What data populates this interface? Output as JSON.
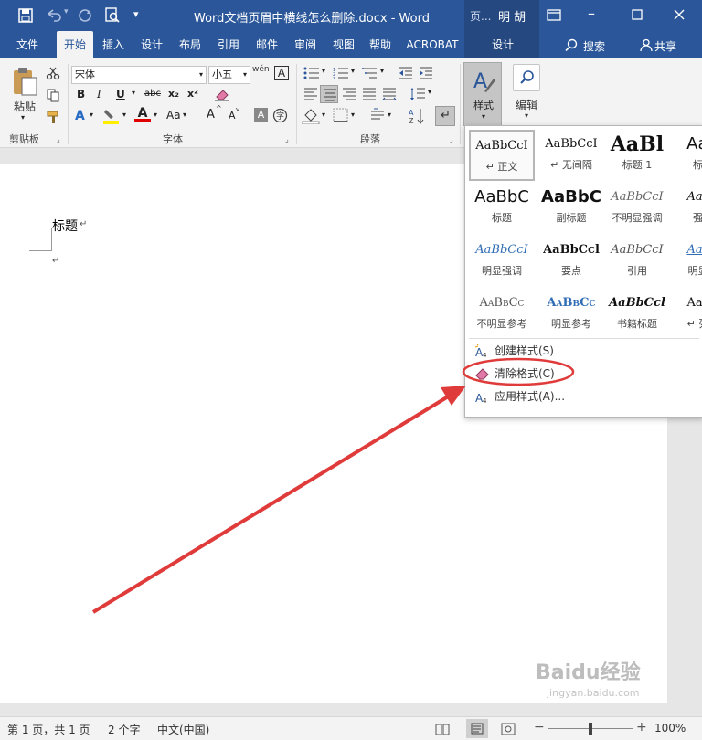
{
  "titlebar": {
    "title": "Word文档页眉中横线怎么删除.docx - Word",
    "context_tab": "页...",
    "user": "明 胡"
  },
  "tabs": [
    "文件",
    "开始",
    "插入",
    "设计",
    "布局",
    "引用",
    "邮件",
    "审阅",
    "视图",
    "帮助",
    "ACROBAT",
    "设计"
  ],
  "search_label": "搜索",
  "share_label": "共享",
  "ribbon": {
    "paste": "粘贴",
    "clipboard_group": "剪贴板",
    "font_name": "宋体",
    "font_size": "小五",
    "font_group": "字体",
    "paragraph_group": "段落",
    "styles_button": "样式",
    "edit_button": "编辑",
    "fmt_bold": "B",
    "fmt_italic": "I",
    "fmt_underline": "U",
    "fmt_strike": "abc",
    "fmt_sub": "x₂",
    "fmt_sup": "x²",
    "fmt_case": "Aa",
    "fmt_grow": "A",
    "fmt_shrink": "A",
    "fmt_clear": "A",
    "wen": "wén",
    "char_border": "A"
  },
  "document": {
    "heading_text": "标题",
    "mark1": "↵",
    "mark2": "↵"
  },
  "styles_gallery": [
    {
      "preview": "AaBbCcI",
      "name": "↵ 正文"
    },
    {
      "preview": "AaBbCcI",
      "name": "↵ 无间隔"
    },
    {
      "preview": "AaBl",
      "name": "标题 1"
    },
    {
      "preview": "AaB",
      "name": "标题"
    },
    {
      "preview": "AaBbC",
      "name": "标题"
    },
    {
      "preview": "AaBbC",
      "name": "副标题"
    },
    {
      "preview": "AaBbCcI",
      "name": "不明显强调"
    },
    {
      "preview": "AaBb",
      "name": "强调"
    },
    {
      "preview": "AaBbCcI",
      "name": "明显强调"
    },
    {
      "preview": "AaBbCcl",
      "name": "要点"
    },
    {
      "preview": "AaBbCcI",
      "name": "引用"
    },
    {
      "preview": "AaBb",
      "name": "明显引"
    },
    {
      "preview": "AaBbCc",
      "name": "不明显参考"
    },
    {
      "preview": "AaBbCc",
      "name": "明显参考"
    },
    {
      "preview": "AaBbCcl",
      "name": "书籍标题"
    },
    {
      "preview": "AaBb",
      "name": "↵ 列表"
    }
  ],
  "styles_menu": [
    {
      "label": "创建样式(S)",
      "icon": "create-style-icon"
    },
    {
      "label": "清除格式(C)",
      "icon": "eraser-icon"
    },
    {
      "label": "应用样式(A)...",
      "icon": "apply-style-icon"
    }
  ],
  "status": {
    "page": "第 1 页，共 1 页",
    "words": "2 个字",
    "language": "中文(中国)",
    "zoom": "100%"
  },
  "colors": {
    "accent": "#2b579a",
    "annotation": "#e03b3b"
  },
  "watermark": {
    "text": "Baidu经验",
    "url": "jingyan.baidu.com"
  }
}
